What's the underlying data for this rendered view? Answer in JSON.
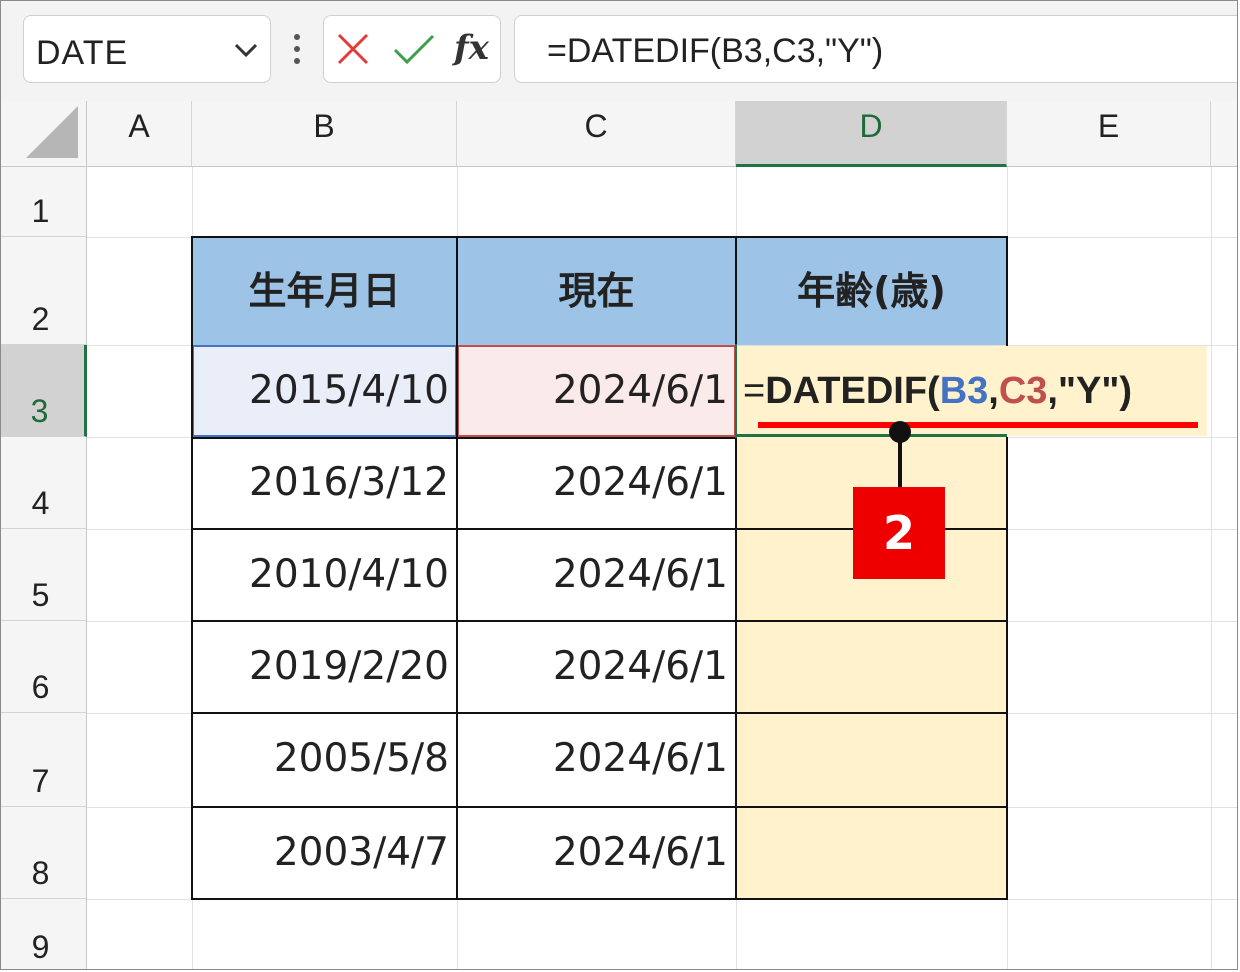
{
  "formula_bar": {
    "name_box": "DATE",
    "fx_label": "fx",
    "formula": "=DATEDIF(B3,C3,\"Y\")"
  },
  "columns": [
    "A",
    "B",
    "C",
    "D",
    "E"
  ],
  "rows": [
    "1",
    "2",
    "3",
    "4",
    "5",
    "6",
    "7",
    "8",
    "9"
  ],
  "selected_cell": "D3",
  "table": {
    "headers": [
      "生年月日",
      "現在",
      "年齢(歳)"
    ],
    "rows": [
      [
        "2015/4/10",
        "2024/6/1"
      ],
      [
        "2016/3/12",
        "2024/6/1"
      ],
      [
        "2010/4/10",
        "2024/6/1"
      ],
      [
        "2019/2/20",
        "2024/6/1"
      ],
      [
        "2005/5/8",
        "2024/6/1"
      ],
      [
        "2003/4/7",
        "2024/6/1"
      ]
    ]
  },
  "in_cell_formula": {
    "eq": "=",
    "func": "DATEDIF(",
    "ref1": "B3",
    "comma1": ",",
    "ref2": "C3",
    "rest": ",\"Y\")"
  },
  "callout": {
    "badge": "2"
  },
  "colors": {
    "header_fill": "#9dc3e6",
    "result_fill": "#fff2cc",
    "ref1_highlight": "#4472c4",
    "ref2_highlight": "#c0504d",
    "accent_red": "#ff0000",
    "excel_green": "#217346"
  }
}
